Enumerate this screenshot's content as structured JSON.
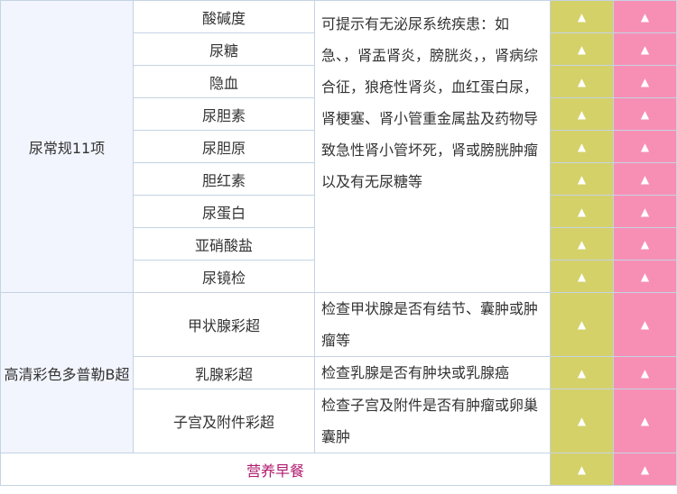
{
  "sections": [
    {
      "category": "尿常规11项",
      "description": "可提示有无泌尿系统疾患：如急、，肾盂肾炎，膀胱炎，，肾病综合征，狼疮性肾炎，血红蛋白尿，肾梗塞、肾小管重金属盐及药物导致急性肾小管坏死，肾或膀胱肿瘤以及有无尿糖等",
      "items": [
        "酸碱度",
        "尿糖",
        "隐血",
        "尿胆素",
        "尿胆原",
        "胆红素",
        "尿蛋白",
        "亚硝酸盐",
        "尿镜检"
      ]
    },
    {
      "category": "高清彩色多普勒B超",
      "items": [
        {
          "name": "甲状腺彩超",
          "description": "检查甲状腺是否有结节、囊肿或肿瘤等"
        },
        {
          "name": "乳腺彩超",
          "description": "检查乳腺是否有肿块或乳腺癌"
        },
        {
          "name": "子宫及附件彩超",
          "description": "检查子宫及附件是否有肿瘤或卵巢囊肿"
        }
      ]
    }
  ],
  "breakfast_label": "营养早餐",
  "mark_symbol": "▲",
  "mark_icon": "triangle-up-icon",
  "colors": {
    "category_bg": "#f2f5fd",
    "border": "#c5d3e3",
    "package_a": "#d4d169",
    "package_b": "#f78fb4",
    "breakfast_text": "#b01a6e"
  }
}
